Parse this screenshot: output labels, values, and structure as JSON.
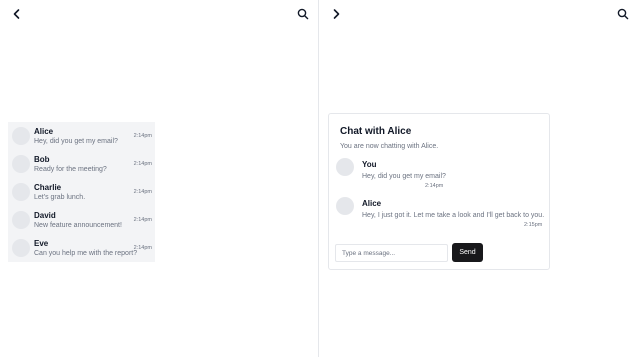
{
  "left_pane": {
    "back_icon": "chevron-left-icon",
    "search_icon": "search-icon",
    "chats": [
      {
        "name": "Alice",
        "preview": "Hey, did you get my email?",
        "time": "2:14pm"
      },
      {
        "name": "Bob",
        "preview": "Ready for the meeting?",
        "time": "2:14pm"
      },
      {
        "name": "Charlie",
        "preview": "Let's grab lunch.",
        "time": "2:14pm"
      },
      {
        "name": "David",
        "preview": "New feature announcement!",
        "time": "2:14pm"
      },
      {
        "name": "Eve",
        "preview": "Can you help me with the report?",
        "time": "2:14pm"
      }
    ]
  },
  "right_pane": {
    "forward_icon": "chevron-right-icon",
    "search_icon": "search-icon",
    "chat": {
      "title": "Chat with Alice",
      "subtitle": "You are now chatting with Alice.",
      "messages": [
        {
          "sender": "You",
          "text": "Hey, did you get my email?",
          "time": "2:14pm"
        },
        {
          "sender": "Alice",
          "text": "Hey, I just got it. Let me take a look and I'll get back to you.",
          "time": "2:15pm"
        }
      ],
      "input_placeholder": "Type a message...",
      "send_label": "Send"
    }
  },
  "colors": {
    "list_bg": "#f3f4f6",
    "avatar": "#e5e7eb",
    "muted_text": "#6b7280",
    "send_button": "#18181b"
  }
}
